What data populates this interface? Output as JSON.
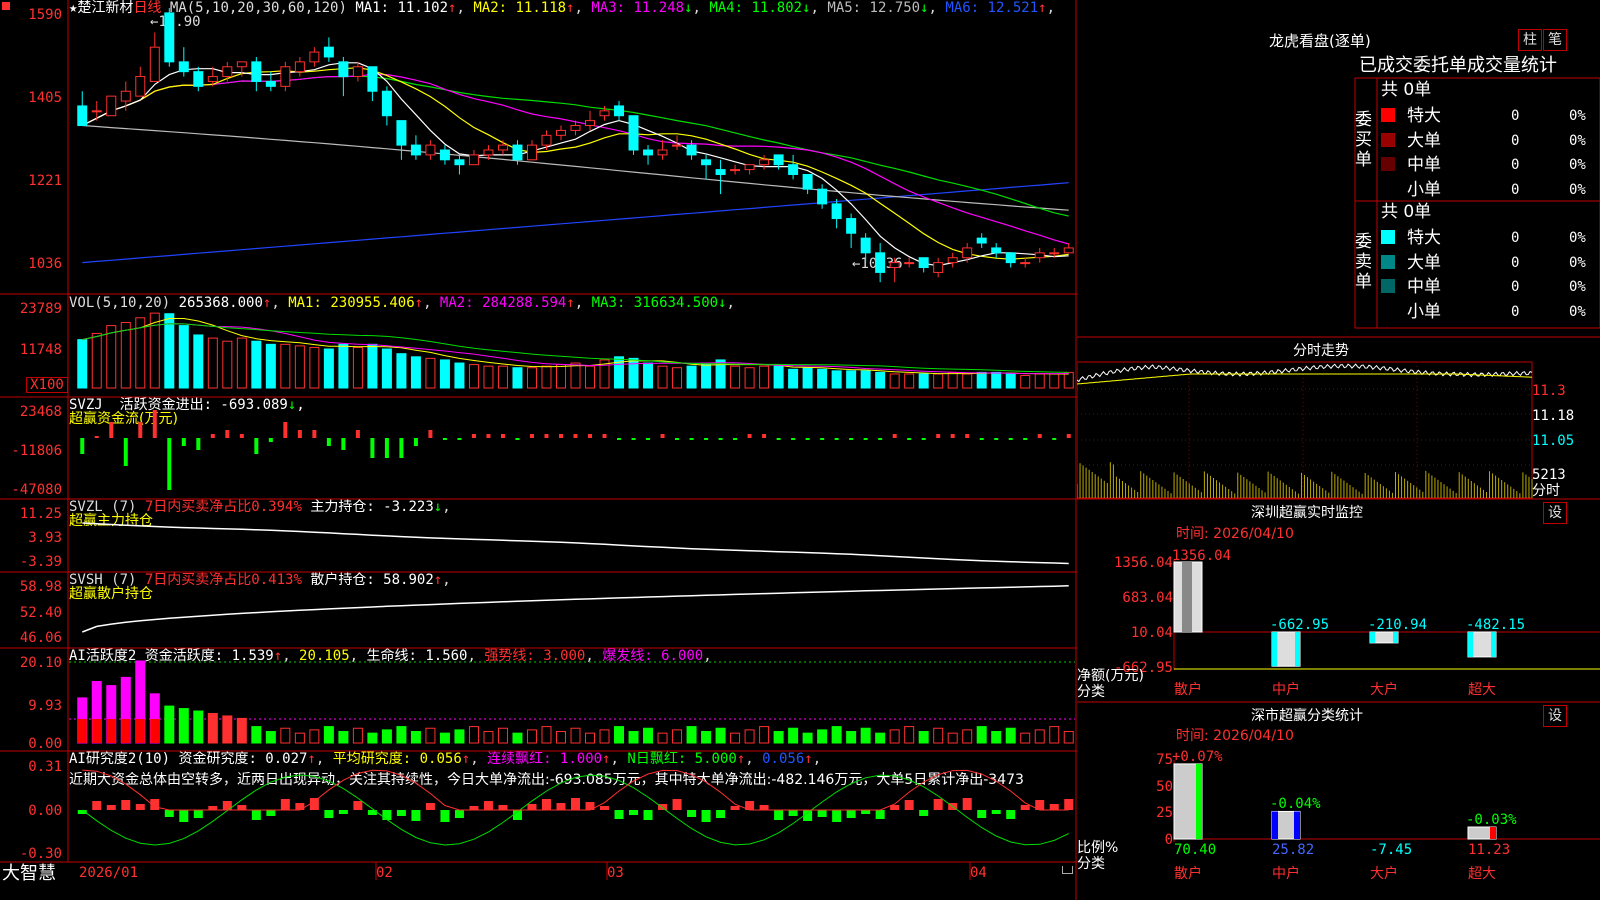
{
  "header": {
    "title": "★楚江新材",
    "period": "日线",
    "ma_label": "MA(5,10,20,30,60,120)",
    "ma": [
      {
        "label": "MA1: 11.102",
        "arrow": "↑",
        "color": "#ffffff"
      },
      {
        "label": "MA2: 11.118",
        "arrow": "↑",
        "color": "#ffff00"
      },
      {
        "label": "MA3: 11.248",
        "arrow": "↓",
        "color": "#ff00ff"
      },
      {
        "label": "MA4: 11.802",
        "arrow": "↓",
        "color": "#00ff00"
      },
      {
        "label": "MA5: 12.750",
        "arrow": "↓",
        "color": "#bbbbbb"
      },
      {
        "label": "MA6: 12.521",
        "arrow": "↑",
        "color": "#2255ff"
      }
    ],
    "high_mark": "15.90",
    "low_mark": "10.36"
  },
  "price_axis": [
    "1590",
    "1405",
    "1221",
    "1036"
  ],
  "vol": {
    "label": "VOL(5,10,20)",
    "value": "265368.000",
    "ma": [
      {
        "label": "MA1: 230955.406",
        "arrow": "↑",
        "color": "#ffff00"
      },
      {
        "label": "MA2: 284288.594",
        "arrow": "↑",
        "color": "#ff00ff"
      },
      {
        "label": "MA3: 316634.500",
        "arrow": "↓",
        "color": "#00ff00"
      }
    ],
    "axis": [
      "23789",
      "11748"
    ],
    "unit": "X100"
  },
  "svzj": {
    "label": "SVZJ",
    "text": "活跃资金进出: -693.089",
    "arrow": "↓",
    "sub": "超赢资金流(万元)",
    "axis": [
      "23468",
      "-11806",
      "-47080"
    ]
  },
  "svzl": {
    "label": "SVZL (7)",
    "pct": "7日内买卖净占比0.394%",
    "main": "主力持仓: -3.223",
    "arrow": "↓",
    "sub": "超赢主力持仓",
    "axis": [
      "11.25",
      "3.93",
      "-3.39"
    ]
  },
  "svsh": {
    "label": "SVSH (7)",
    "pct": "7日内买卖净占比0.413%",
    "main": "散户持仓: 58.902",
    "arrow": "↑",
    "sub": "超赢散户持仓",
    "axis": [
      "58.98",
      "52.40",
      "46.06"
    ]
  },
  "ai_active": {
    "label": "AI活跃度2",
    "items": [
      {
        "label": "资金活跃度: 1.539",
        "arrow": "↑",
        "color": "#ffffff"
      },
      {
        "label": "20.105",
        "arrow": "",
        "color": "#ffff00"
      },
      {
        "label": "生命线: 1.560",
        "arrow": "",
        "color": "#ffffff"
      },
      {
        "label": "强势线: 3.000",
        "arrow": "",
        "color": "#ff3030"
      },
      {
        "label": "爆发线: 6.000",
        "arrow": "",
        "color": "#ff00ff"
      }
    ],
    "axis": [
      "20.10",
      "9.93",
      "0.00"
    ]
  },
  "ai_research": {
    "label": "AI研究度2(10)",
    "items": [
      {
        "label": "资金研究度: 0.027",
        "arrow": "↑",
        "color": "#ffffff"
      },
      {
        "label": "平均研究度: 0.056",
        "arrow": "↑",
        "color": "#ffff00"
      },
      {
        "label": "连续飘红: 1.000",
        "arrow": "↑",
        "color": "#ff00ff"
      },
      {
        "label": "N日飘红: 5.000",
        "arrow": "↑",
        "color": "#00ff00"
      },
      {
        "label": "0.056",
        "arrow": "↑",
        "color": "#2255ff"
      }
    ],
    "comment": "近期大资金总体由空转多，近两日出现异动，关注其持续性，今日大单净流出:-693.085万元，其中特大单净流出:-482.146万元，大单5日累计净出-3473",
    "axis": [
      "0.31",
      "0.00",
      "-0.30"
    ]
  },
  "date_axis": [
    "2026/01",
    "02",
    "03",
    "04"
  ],
  "brand": "大智慧",
  "right_panel": {
    "lhb_title": "龙虎看盘(逐单)",
    "btn_zhu": "柱",
    "btn_bi": "笔",
    "sub_title": "已成交委托单成交量统计",
    "buy": {
      "side_label": "委买单",
      "total": "共 0单",
      "rows": [
        {
          "label": "特大",
          "count": "0",
          "pct": "0%",
          "color": "#ff0000"
        },
        {
          "label": "大单",
          "count": "0",
          "pct": "0%",
          "color": "#990000"
        },
        {
          "label": "中单",
          "count": "0",
          "pct": "0%",
          "color": "#660000"
        },
        {
          "label": "小单",
          "count": "0",
          "pct": "0%",
          "color": ""
        }
      ]
    },
    "sell": {
      "side_label": "委卖单",
      "total": "共 0单",
      "rows": [
        {
          "label": "特大",
          "count": "0",
          "pct": "0%",
          "color": "#00ffff"
        },
        {
          "label": "大单",
          "count": "0",
          "pct": "0%",
          "color": "#008888"
        },
        {
          "label": "中单",
          "count": "0",
          "pct": "0%",
          "color": "#006666"
        },
        {
          "label": "小单",
          "count": "0",
          "pct": "0%",
          "color": ""
        }
      ]
    },
    "fs_title": "分时走势",
    "fs_axis": [
      "11.3",
      "11.18",
      "11.05"
    ],
    "fs_vol": "5213",
    "fs_vol_label": "分时",
    "sz_monitor": {
      "title": "深圳超赢实时监控",
      "btn": "设",
      "time": "时间: 2026/04/10",
      "axis": [
        "1356.04",
        "683.04",
        "10.04",
        "-662.95"
      ],
      "ylabel": "净额(万元)",
      "xlabel": "分类",
      "bars": [
        {
          "cat": "散户",
          "value": 1356.04,
          "label": "1356.04"
        },
        {
          "cat": "中户",
          "value": -662.95,
          "label": "-662.95"
        },
        {
          "cat": "大户",
          "value": -210.94,
          "label": "-210.94"
        },
        {
          "cat": "超大",
          "value": -482.15,
          "label": "-482.15"
        }
      ]
    },
    "sz_class": {
      "title": "深市超赢分类统计",
      "btn": "设",
      "time": "时间: 2026/04/10",
      "axis": [
        "75",
        "50",
        "25",
        "0"
      ],
      "ylabel": "比例%",
      "xlabel": "分类",
      "bars": [
        {
          "cat": "散户",
          "value": 70.4,
          "label": "70.40",
          "chg": "+0.07%"
        },
        {
          "cat": "中户",
          "value": 25.82,
          "label": "25.82",
          "chg": "-0.04%"
        },
        {
          "cat": "大户",
          "value": -7.45,
          "label": "-7.45",
          "chg": ""
        },
        {
          "cat": "超大",
          "value": 11.23,
          "label": "11.23",
          "chg": "-0.03%"
        }
      ]
    }
  },
  "chart_data": {
    "type": "candlestick",
    "ohlc": [
      [
        14.0,
        14.3,
        13.7,
        13.6
      ],
      [
        13.9,
        14.1,
        13.7,
        13.9
      ],
      [
        13.8,
        14.2,
        13.8,
        14.2
      ],
      [
        14.1,
        14.5,
        13.9,
        14.3
      ],
      [
        14.2,
        14.8,
        14.3,
        14.6
      ],
      [
        14.5,
        15.5,
        14.7,
        15.2
      ],
      [
        15.9,
        16.0,
        14.8,
        14.9
      ],
      [
        14.9,
        15.2,
        14.6,
        14.7
      ],
      [
        14.7,
        14.8,
        14.3,
        14.4
      ],
      [
        14.5,
        14.8,
        14.4,
        14.6
      ],
      [
        14.6,
        14.9,
        14.5,
        14.8
      ],
      [
        14.8,
        14.9,
        14.6,
        14.9
      ],
      [
        14.9,
        15.0,
        14.3,
        14.5
      ],
      [
        14.5,
        14.7,
        14.3,
        14.4
      ],
      [
        14.4,
        14.9,
        14.3,
        14.8
      ],
      [
        14.7,
        15.0,
        14.6,
        14.9
      ],
      [
        14.9,
        15.2,
        14.8,
        15.1
      ],
      [
        15.2,
        15.4,
        14.9,
        15.0
      ],
      [
        14.9,
        15.0,
        14.2,
        14.6
      ],
      [
        14.6,
        14.9,
        14.5,
        14.8
      ],
      [
        14.8,
        14.8,
        14.1,
        14.3
      ],
      [
        14.3,
        14.4,
        13.6,
        13.8
      ],
      [
        13.7,
        13.7,
        12.9,
        13.2
      ],
      [
        13.2,
        13.4,
        12.9,
        13.0
      ],
      [
        13.0,
        13.3,
        12.9,
        13.2
      ],
      [
        13.1,
        13.2,
        12.8,
        12.9
      ],
      [
        12.9,
        13.0,
        12.6,
        12.8
      ],
      [
        12.8,
        13.1,
        12.8,
        13.0
      ],
      [
        13.0,
        13.2,
        12.9,
        13.1
      ],
      [
        13.1,
        13.3,
        13.0,
        13.2
      ],
      [
        13.2,
        13.3,
        12.8,
        12.9
      ],
      [
        12.9,
        13.3,
        12.9,
        13.2
      ],
      [
        13.2,
        13.5,
        13.1,
        13.4
      ],
      [
        13.4,
        13.6,
        13.3,
        13.5
      ],
      [
        13.5,
        13.7,
        13.4,
        13.6
      ],
      [
        13.6,
        13.9,
        13.5,
        13.7
      ],
      [
        13.8,
        14.0,
        13.7,
        13.9
      ],
      [
        14.0,
        14.1,
        13.7,
        13.8
      ],
      [
        13.8,
        13.8,
        13.0,
        13.1
      ],
      [
        13.1,
        13.2,
        12.8,
        13.0
      ],
      [
        13.0,
        13.3,
        12.9,
        13.1
      ],
      [
        13.2,
        13.4,
        13.1,
        13.2
      ],
      [
        13.2,
        13.3,
        12.9,
        13.0
      ],
      [
        12.9,
        13.0,
        12.5,
        12.8
      ],
      [
        12.7,
        12.9,
        12.2,
        12.6
      ],
      [
        12.7,
        12.8,
        12.6,
        12.7
      ],
      [
        12.7,
        12.8,
        12.6,
        12.8
      ],
      [
        12.8,
        13.0,
        12.7,
        12.9
      ],
      [
        13.0,
        13.0,
        12.7,
        12.8
      ],
      [
        12.8,
        13.0,
        12.5,
        12.6
      ],
      [
        12.6,
        12.6,
        12.2,
        12.3
      ],
      [
        12.3,
        12.4,
        11.9,
        12.0
      ],
      [
        12.0,
        12.1,
        11.5,
        11.7
      ],
      [
        11.7,
        11.8,
        11.1,
        11.4
      ],
      [
        11.3,
        11.4,
        10.8,
        11.0
      ],
      [
        11.0,
        11.2,
        10.4,
        10.6
      ],
      [
        10.7,
        10.9,
        10.4,
        10.8
      ],
      [
        10.8,
        10.9,
        10.7,
        10.8
      ],
      [
        10.9,
        10.9,
        10.6,
        10.7
      ],
      [
        10.6,
        10.9,
        10.5,
        10.8
      ],
      [
        10.8,
        11.0,
        10.7,
        10.9
      ],
      [
        10.9,
        11.2,
        10.8,
        11.1
      ],
      [
        11.3,
        11.4,
        11.1,
        11.2
      ],
      [
        11.1,
        11.2,
        10.9,
        11.0
      ],
      [
        11.0,
        11.0,
        10.7,
        10.8
      ],
      [
        10.8,
        10.9,
        10.7,
        10.8
      ],
      [
        10.9,
        11.1,
        10.8,
        11.0
      ],
      [
        11.0,
        11.1,
        10.9,
        11.0
      ],
      [
        11.0,
        11.2,
        11.0,
        11.1
      ]
    ],
    "volume": [
      155,
      175,
      200,
      210,
      225,
      240,
      238,
      200,
      170,
      160,
      150,
      160,
      150,
      140,
      140,
      135,
      130,
      125,
      140,
      130,
      140,
      125,
      110,
      100,
      95,
      90,
      80,
      75,
      70,
      70,
      65,
      65,
      70,
      75,
      80,
      70,
      90,
      100,
      95,
      80,
      70,
      65,
      70,
      80,
      90,
      70,
      65,
      70,
      70,
      60,
      65,
      60,
      55,
      55,
      55,
      50,
      45,
      45,
      45,
      45,
      50,
      45,
      50,
      50,
      45,
      40,
      45,
      45,
      50
    ],
    "date_ticks": [
      "2026/01",
      "02",
      "03",
      "04"
    ]
  }
}
